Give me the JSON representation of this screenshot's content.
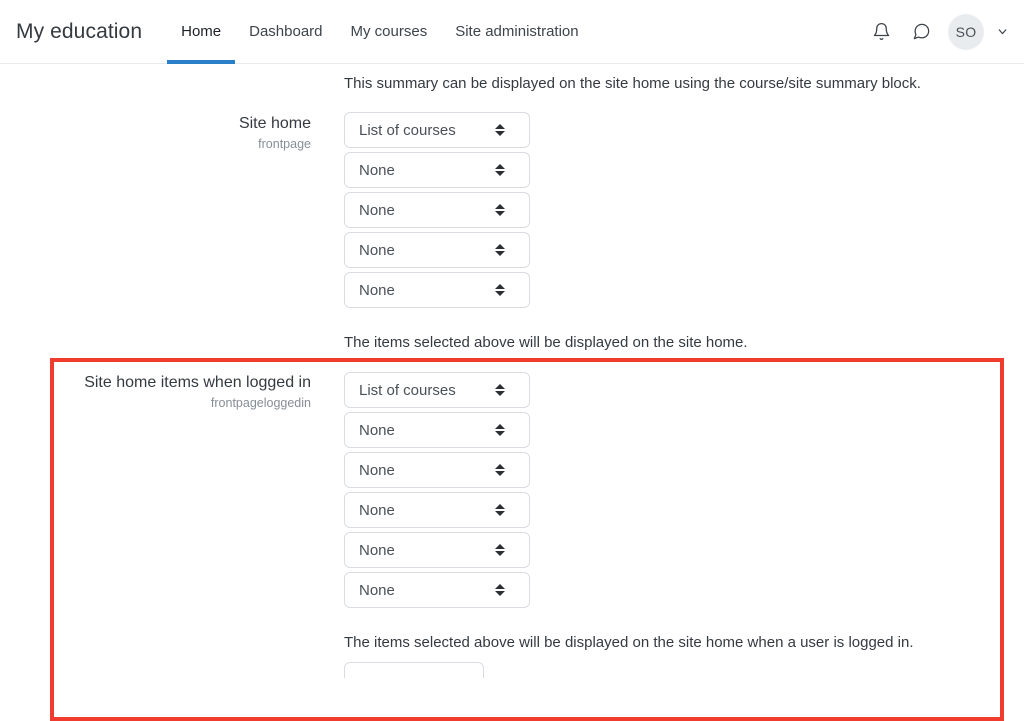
{
  "header": {
    "brand": "My education",
    "tabs": [
      {
        "label": "Home",
        "active": true
      },
      {
        "label": "Dashboard",
        "active": false
      },
      {
        "label": "My courses",
        "active": false
      },
      {
        "label": "Site administration",
        "active": false
      }
    ],
    "icons": {
      "notifications": "bell-icon",
      "messages": "message-bubble-icon",
      "caret": "chevron-down-icon"
    },
    "avatar_initials": "SO"
  },
  "colors": {
    "accent_blue": "#2a7fc9",
    "highlight_red": "#f03c2e",
    "text": "#343a40",
    "muted": "#868e96",
    "border": "#d9dde2"
  },
  "main": {
    "intro_text": "This summary can be displayed on the site home using the course/site summary block.",
    "frontpage": {
      "label": "Site home",
      "shortname": "frontpage",
      "selects": [
        {
          "value": "List of courses"
        },
        {
          "value": "None"
        },
        {
          "value": "None"
        },
        {
          "value": "None"
        },
        {
          "value": "None"
        }
      ],
      "help": "The items selected above will be displayed on the site home."
    },
    "frontpageloggedin": {
      "label": "Site home items when logged in",
      "shortname": "frontpageloggedin",
      "selects": [
        {
          "value": "List of courses"
        },
        {
          "value": "None"
        },
        {
          "value": "None"
        },
        {
          "value": "None"
        },
        {
          "value": "None"
        },
        {
          "value": "None"
        }
      ],
      "help": "The items selected above will be displayed on the site home when a user is logged in."
    }
  }
}
